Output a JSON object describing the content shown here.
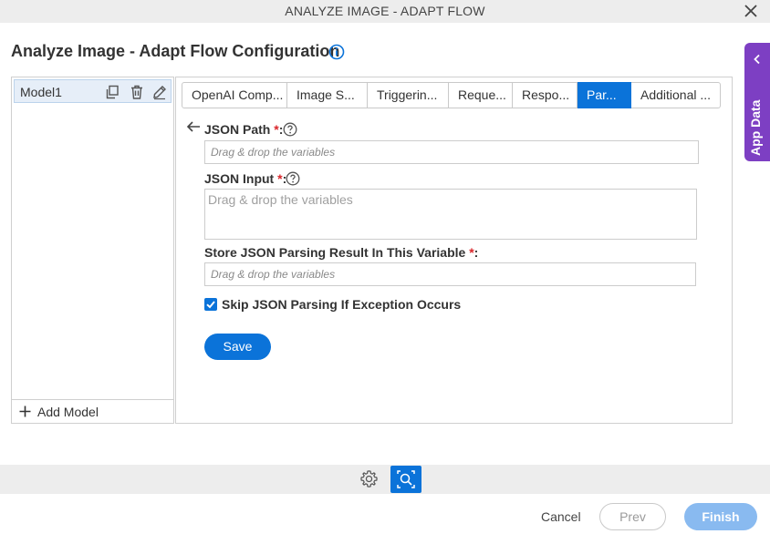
{
  "window": {
    "title": "ANALYZE IMAGE - ADAPT FLOW",
    "close_icon": "close-icon"
  },
  "page": {
    "title": "Analyze Image - Adapt Flow Configuration",
    "info_icon": "info-icon"
  },
  "app_data": {
    "label": "App Data",
    "icon": "chevron-left-icon",
    "color": "#7d3fc3"
  },
  "models": {
    "items": [
      {
        "label": "Model1",
        "icons": [
          "copy-icon",
          "delete-icon",
          "edit-icon"
        ]
      }
    ],
    "add_label": "Add Model"
  },
  "tabs": [
    {
      "label": "OpenAI Comp...",
      "active": false
    },
    {
      "label": "Image S...",
      "active": false
    },
    {
      "label": "Triggerin...",
      "active": false
    },
    {
      "label": "Reque...",
      "active": false
    },
    {
      "label": "Respo...",
      "active": false
    },
    {
      "label": "Par...",
      "active": true
    },
    {
      "label": "Additional ...",
      "active": false
    }
  ],
  "form": {
    "json_path": {
      "label": "JSON Path",
      "required": "*",
      "suffix": ":",
      "placeholder": "Drag & drop the variables"
    },
    "json_input": {
      "label": "JSON Input",
      "required": "*",
      "suffix": ":",
      "placeholder": "Drag & drop the variables"
    },
    "store_result": {
      "label": "Store JSON Parsing Result In This Variable",
      "required": "*",
      "suffix": ":",
      "placeholder": "Drag & drop the variables"
    },
    "skip_exception": {
      "label": "Skip JSON Parsing If Exception Occurs",
      "checked": true
    },
    "save_label": "Save"
  },
  "footer": {
    "cancel": "Cancel",
    "prev": "Prev",
    "finish": "Finish"
  },
  "colors": {
    "accent": "#0b73d9",
    "required": "#d9262b",
    "finish_disabled": "#89baf0"
  }
}
